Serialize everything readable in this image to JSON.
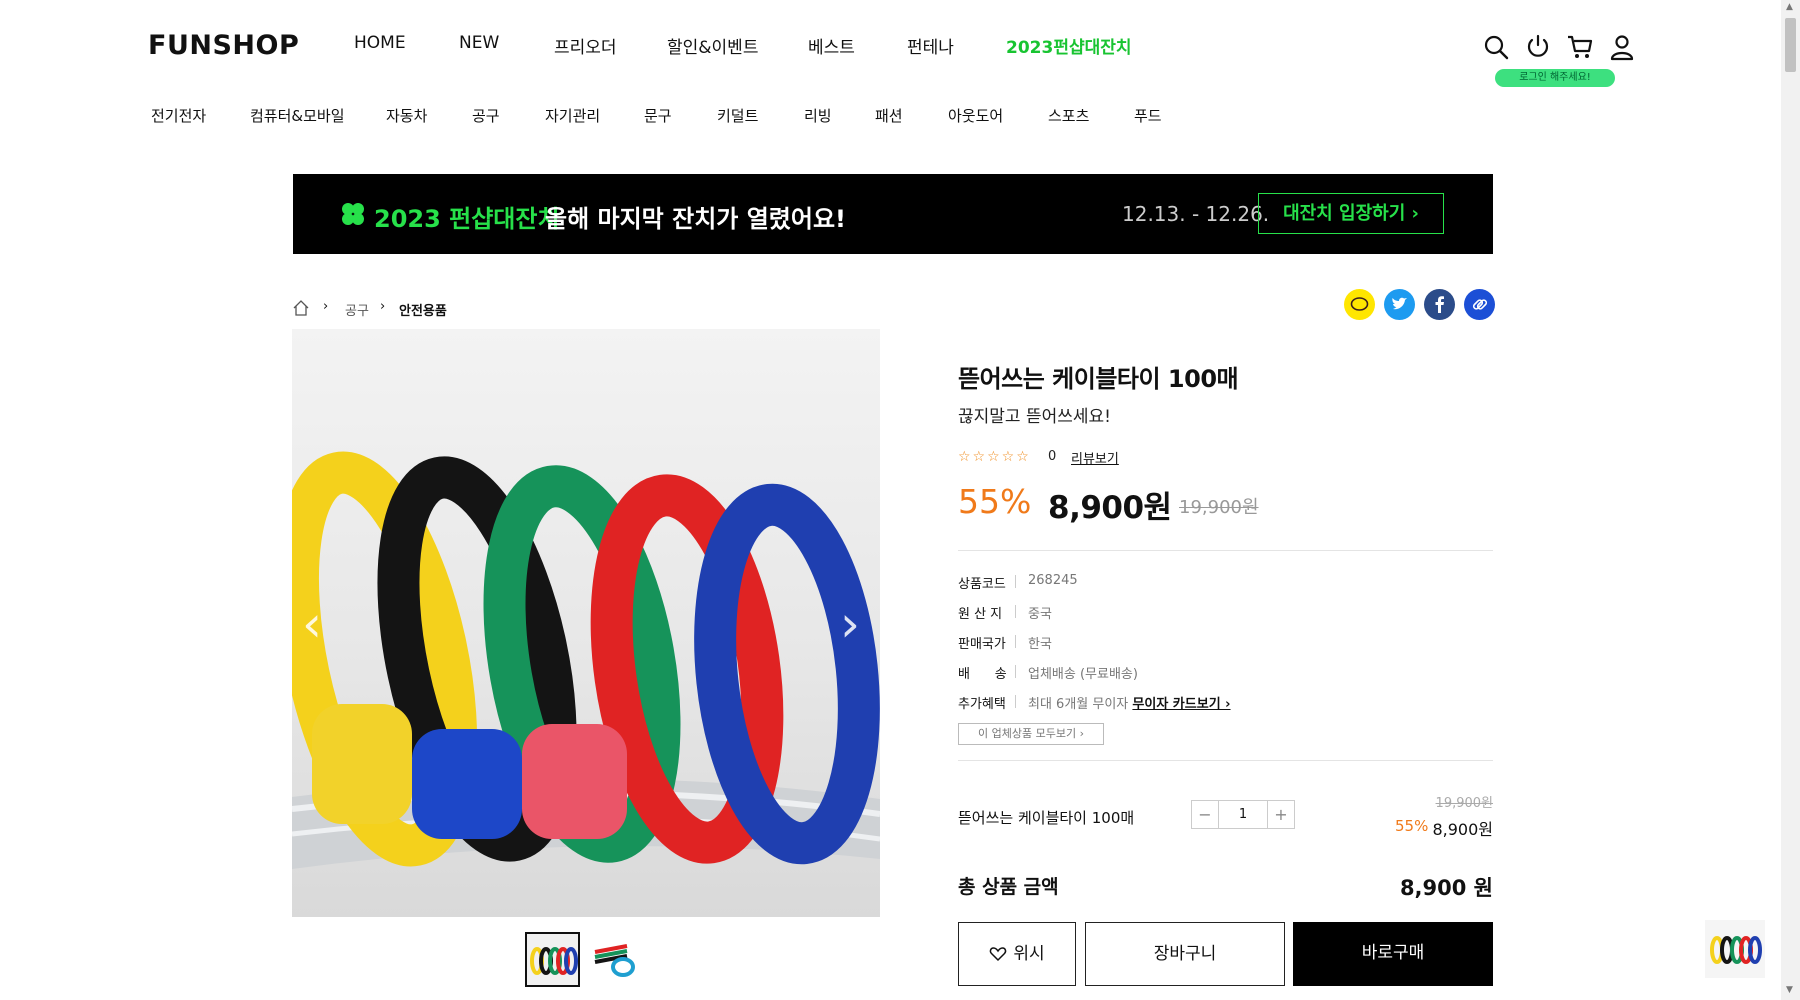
{
  "header": {
    "logo": "FUNSHOP",
    "gnb": [
      "HOME",
      "NEW",
      "프리오더",
      "할인&이벤트",
      "베스트",
      "펀테나",
      "2023펀샵대잔치"
    ],
    "login_tip": "로그인 해주세요!",
    "icons": [
      "search-icon",
      "power-icon",
      "cart-icon",
      "user-icon"
    ]
  },
  "categories": [
    "전기전자",
    "컴퓨터&모바일",
    "자동차",
    "공구",
    "자기관리",
    "문구",
    "키덜트",
    "리빙",
    "패션",
    "아웃도어",
    "스포츠",
    "푸드"
  ],
  "banner": {
    "title": "2023 펀샵대잔치",
    "text": "올해 마지막 잔치가 열렸어요!",
    "date": "12.13. - 12.26.",
    "button": "대잔치 입장하기 ›"
  },
  "breadcrumb": [
    "공구",
    "안전용품"
  ],
  "product": {
    "title": "뜯어쓰는 케이블타이 100매",
    "subtitle": "끊지말고 뜯어쓰세요!",
    "stars": "☆☆☆☆☆",
    "review_count": "0",
    "review_link": "리뷰보기",
    "discount": "55%",
    "price": "8,900원",
    "original_price": "19,900원",
    "info": [
      {
        "key": "상품코드",
        "value": "268245"
      },
      {
        "key": "원 산 지",
        "value": "중국"
      },
      {
        "key": "판매국가",
        "value": "한국"
      },
      {
        "key": "배      송",
        "value": "업체배송 (무료배송)"
      },
      {
        "key": "추가혜택",
        "value": "최대 6개월 무이자"
      }
    ],
    "card_link": "무이자 카드보기 ›",
    "seller_button": "이 업체상품 모두보기 ›"
  },
  "option": {
    "name": "뜯어쓰는 케이블타이 100매",
    "quantity": "1",
    "original_price": "19,900원",
    "discount": "55%",
    "price": "8,900원"
  },
  "total": {
    "label": "총 상품 금액",
    "value": "8,900 원"
  },
  "buttons": {
    "wish": "위시",
    "cart": "장바구니",
    "buy": "바로구매"
  },
  "colors": {
    "accent_green": "#27e14a",
    "discount_orange": "#f07a1a"
  }
}
